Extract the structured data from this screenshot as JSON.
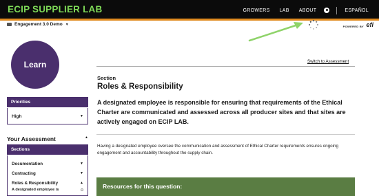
{
  "app": {
    "logo": "ECIP SUPPLIER LAB"
  },
  "nav": {
    "items": [
      "GROWERS",
      "LAB",
      "ABOUT"
    ],
    "language": "ESPAÑOL"
  },
  "demo": {
    "label": "Engagement 3.0 Demo"
  },
  "branding": {
    "powered_by": "POWERED BY",
    "brand": "efi"
  },
  "learn": {
    "label": "Learn"
  },
  "priorities": {
    "title": "Priorities",
    "selected": "High"
  },
  "assessment": {
    "title": "Your Assessment",
    "sections_title": "Sections",
    "items": [
      "Documentation",
      "Contracting",
      "Roles & Responsibility"
    ],
    "subitem": "A designated employee is"
  },
  "main": {
    "switch_link": "Switch to Assessment",
    "section_label": "Section",
    "section_title": "Roles & Responsibility",
    "question": "A designated employee is responsible for ensuring that requirements of the Ethical Charter are communicated and assessed across all producer sites and that sites are actively engaged on ECIP LAB.",
    "description": "Having a designated employee oversee the communication and assessment of Ethical Charter requirements ensures ongoing engagement and accountability throughout the supply chain.",
    "resources_title": "Resources for this question:"
  },
  "colors": {
    "accent_purple": "#4a2f6d",
    "logo_green": "#7ed957",
    "resources_green": "#5a7d43",
    "arrow_green": "#8fd36a"
  },
  "icons": [
    "user-icon",
    "chevron-down-icon",
    "chevron-up-icon",
    "loading-spinner-icon",
    "annotation-arrow"
  ]
}
